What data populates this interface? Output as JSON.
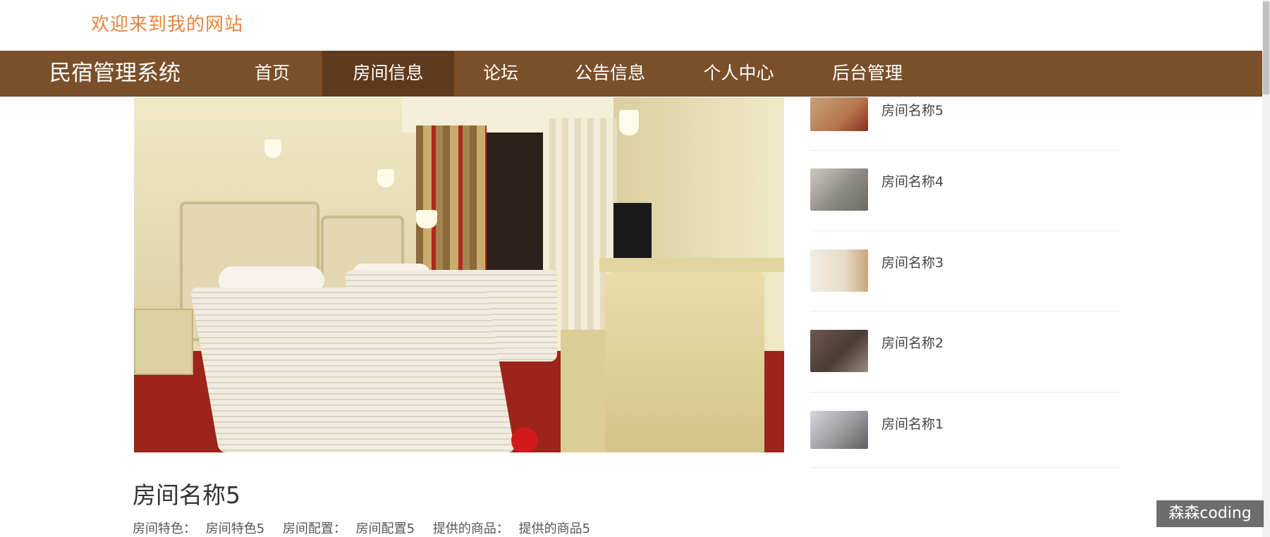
{
  "header": {
    "welcome": "欢迎来到我的网站"
  },
  "nav": {
    "brand": "民宿管理系统",
    "items": [
      {
        "label": "首页"
      },
      {
        "label": "房间信息",
        "active": true
      },
      {
        "label": "论坛"
      },
      {
        "label": "公告信息"
      },
      {
        "label": "个人中心"
      },
      {
        "label": "后台管理"
      }
    ],
    "bg_color": "#7a4f2a",
    "active_color": "#603a1c"
  },
  "sidebar": {
    "items": [
      {
        "name": "房间名称5",
        "thumb_color": "#b5764d"
      },
      {
        "name": "房间名称4",
        "thumb_color": "#8c8a82"
      },
      {
        "name": "房间名称3",
        "thumb_color": "#e6dcc8"
      },
      {
        "name": "房间名称2",
        "thumb_color": "#4a3b33"
      },
      {
        "name": "房间名称1",
        "thumb_color": "#9a9a9e"
      }
    ]
  },
  "room": {
    "title": "房间名称5",
    "feature_label": "房间特色：",
    "feature_value": "房间特色5",
    "config_label": "房间配置：",
    "config_value": "房间配置5",
    "goods_label": "提供的商品：",
    "goods_value": "提供的商品5"
  },
  "watermark": "森森coding",
  "accent_color": "#e8843a"
}
